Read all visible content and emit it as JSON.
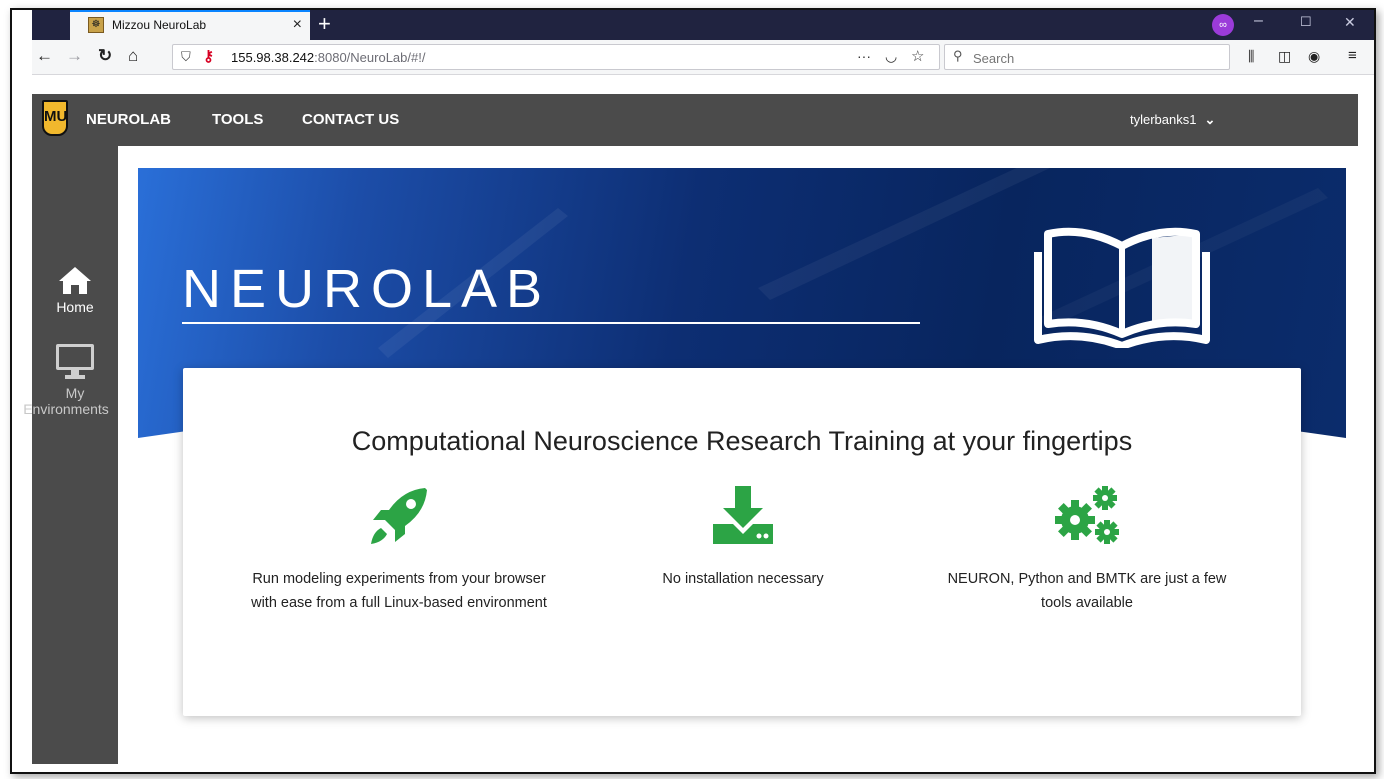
{
  "browser": {
    "tab_title": "Mizzou NeuroLab",
    "tab_close": "×",
    "new_tab": "+",
    "url_host": "155.98.38.242",
    "url_rest": ":8080/NeuroLab/#!/",
    "page_actions": "···",
    "search_placeholder": "Search",
    "window_minimize": "–",
    "window_maximize": "☐",
    "window_close": "✕"
  },
  "header": {
    "logo_text": "MU",
    "nav": [
      {
        "label": "NEUROLAB"
      },
      {
        "label": "TOOLS"
      },
      {
        "label": "CONTACT US"
      }
    ],
    "username": "tylerbanks1",
    "user_chevron": "⌄"
  },
  "sidebar": {
    "items": [
      {
        "label": "Home",
        "icon": "home-icon"
      },
      {
        "label": "My Environments",
        "label_line1": "My",
        "label_line2": "Environments",
        "icon": "monitor-icon"
      }
    ]
  },
  "hero": {
    "title": "NEUROLAB",
    "icon": "open-book-icon"
  },
  "card": {
    "title": "Computational Neuroscience Research Training at your fingertips",
    "features": [
      {
        "icon": "rocket-icon",
        "text": "Run modeling experiments from your browser with ease from a full Linux-based environment"
      },
      {
        "icon": "download-icon",
        "text": "No installation necessary"
      },
      {
        "icon": "gears-icon",
        "text": "NEURON, Python and BMTK are just a few tools available"
      }
    ],
    "accent_color": "#2ca445"
  }
}
